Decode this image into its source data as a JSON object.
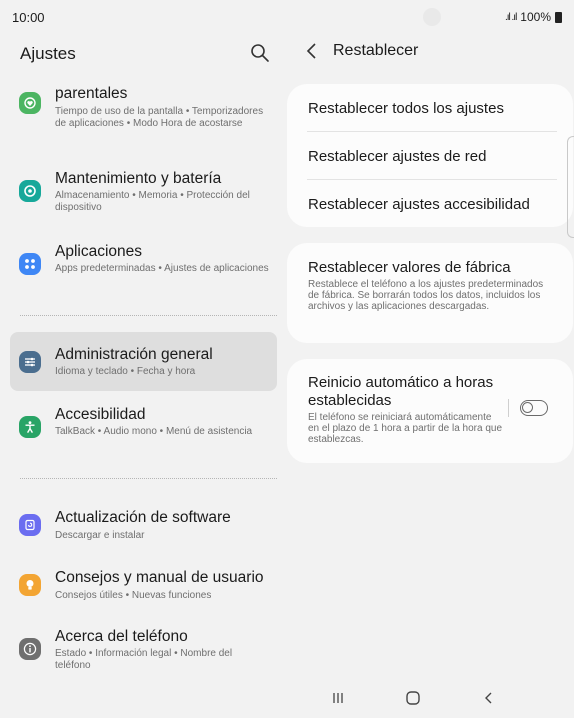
{
  "status_bar": {
    "time": "10:00",
    "signal": ".ıl .ıl",
    "battery_text": "100%"
  },
  "left_panel": {
    "title": "Ajustes",
    "items": [
      {
        "title": "parentales",
        "subtitle": "Tiempo de uso de la pantalla  •  Temporizadores de aplicaciones  •  Modo Hora de acostarse",
        "icon": "heart-icon",
        "color": "#4cb562"
      },
      {
        "title": "Mantenimiento y batería",
        "subtitle": "Almacenamiento  •  Memoria  •  Protección del dispositivo",
        "icon": "maintenance-icon",
        "color": "#17a89a"
      },
      {
        "title": "Aplicaciones",
        "subtitle": "Apps predeterminadas  •  Ajustes de aplicaciones",
        "icon": "apps-icon",
        "color": "#3f87f5"
      },
      {
        "title": "Administración general",
        "subtitle": "Idioma y teclado  •  Fecha y hora",
        "icon": "sliders-icon",
        "color": "#4b6e8f",
        "selected": true
      },
      {
        "title": "Accesibilidad",
        "subtitle": "TalkBack  •  Audio mono  •  Menú de asistencia",
        "icon": "accessibility-icon",
        "color": "#29a466"
      },
      {
        "title": "Actualización de software",
        "subtitle": "Descargar e instalar",
        "icon": "update-icon",
        "color": "#6b6df0"
      },
      {
        "title": "Consejos y manual de usuario",
        "subtitle": "Consejos útiles  •  Nuevas funciones",
        "icon": "lightbulb-icon",
        "color": "#f3a533"
      },
      {
        "title": "Acerca del teléfono",
        "subtitle": "Estado  •  Información legal  •  Nombre del teléfono",
        "icon": "info-icon",
        "color": "#6f6f6f"
      }
    ]
  },
  "right_panel": {
    "title": "Restablecer",
    "reset_group": [
      "Restablecer todos los ajustes",
      "Restablecer ajustes de red",
      "Restablecer ajustes accesibilidad"
    ],
    "factory": {
      "title": "Restablecer valores de fábrica",
      "desc": "Restablece el teléfono a los ajustes predeterminados de fábrica. Se borrarán todos los datos, incluidos los archivos y las aplicaciones descargadas."
    },
    "auto_restart": {
      "title": "Reinicio automático a horas establecidas",
      "desc": "El teléfono se reiniciará automáticamente en el plazo de 1 hora a partir de la hora que establezcas.",
      "enabled": false
    }
  },
  "nav_bar": {
    "buttons": [
      "recents-icon",
      "home-icon",
      "back-icon"
    ]
  }
}
